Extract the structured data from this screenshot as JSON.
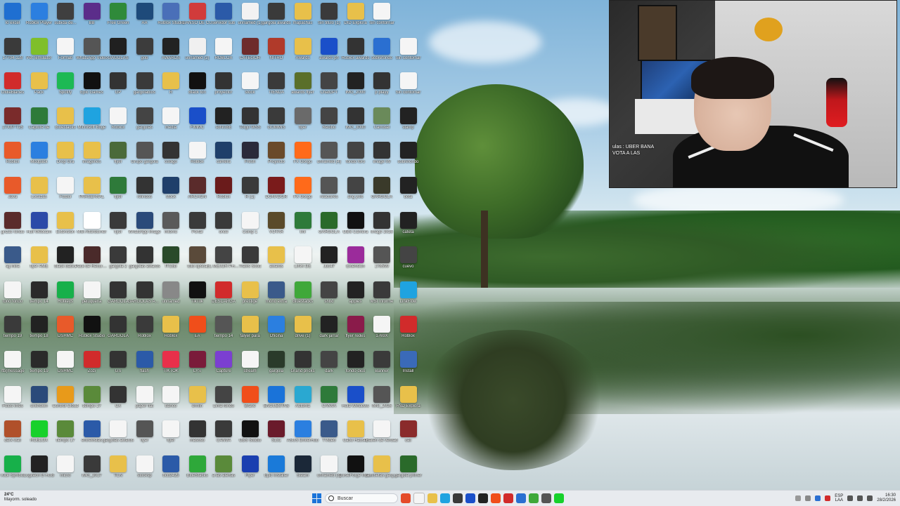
{
  "taskbar": {
    "weather_temp": "24°C",
    "weather_desc": "Mayorm. soleado",
    "search_label": "Buscar",
    "lang_top": "ESP",
    "lang_bottom": "LAA",
    "time": "16:30",
    "date": "28/2/2026"
  },
  "webcam": {
    "chat_line1": "ulas : UBER BANA",
    "chat_line2": "VOTA A LAS"
  },
  "colors": {
    "taskbar_bg": "#e8ebef",
    "start_blue": "#1a73d9"
  },
  "desktop": {
    "rows": [
      [
        "lo excel",
        "Roblox Player",
        "subida-de...",
        "BB",
        "Free Green",
        "AA",
        "Roblox Studio",
        "GANSO DE CU",
        "servidor sub",
        "unnamed (1)",
        "gargola awards",
        "mapachas",
        "Sin titulo (1)",
        "DID Explora",
        "Sin contornar"
      ],
      [
        "17704-128",
        "Pet Simulator",
        "Formati",
        "WhatsApp Video",
        "GAGOLAS",
        "gob",
        "AWARDS",
        "unnamed (2)",
        "ROBLOX",
        "CATEGOR",
        "NITRO",
        "Awards",
        "awards pn",
        "Roblox awards",
        "sobrefondo",
        "Sin contornar"
      ],
      [
        "OldieBlanes",
        "Pack",
        "Spotify",
        "Epic Games",
        "GP",
        "gargolabios",
        "R",
        "Black ton",
        "proyector",
        "stock",
        "TIENDA",
        "awards flyer",
        "ChatGPT",
        "IMG_2000",
        "p playy",
        "Sin contornar"
      ],
      [
        "17X07-T25",
        "Capture de",
        "Bluestacks",
        "Microsoft Edge",
        "Roblox",
        "gargolas",
        "media",
        "FIMMC",
        "sdNUBE",
        "Torgo WSS",
        "GOMMIS",
        "flyer",
        "Recibo",
        "IMG_3000",
        "Carrusel",
        "stamp"
      ],
      [
        "Roblox",
        "Modpack",
        "Drop Gra",
        "imagenes",
        "flyer",
        "Grupo gargola",
        "codigo",
        "Roblox",
        "camera",
        "Fresh",
        "Proyecto",
        "FX Gorgo",
        "unnamed (4)",
        "fondo foro",
        "image 09",
        "sobrefondo"
      ],
      [
        "Java",
        "Locazas",
        "Futbol",
        "PARSEANAL",
        "flyer",
        "relindos",
        "stock",
        "ARCHON",
        "Roblox",
        "R (1)",
        "DONADOR",
        "FX Gorgo",
        "reactores",
        "ang yols",
        "GARGOLA",
        "bota"
      ],
      [
        "gnzas fondo",
        "Huli Webcam",
        "Extension",
        "MSI Afterburner",
        "flyer",
        "WhatsApp Image",
        "mlomo",
        "Portal",
        "once",
        "Comp 1",
        "VOTAR",
        "Iml",
        "GARGOLA",
        "OBS Camera",
        "image 2026",
        "cafeta"
      ],
      [
        "sg mira",
        "flyer AME",
        "black backs",
        "Pack de Recursos",
        "gargola 2",
        "gargolas awards",
        "fTC8b",
        "toto upsca",
        "EL MEJOR PHONK",
        "Travis Scott",
        "awards",
        "LINK-DE",
        "Jbc47",
        "Extension",
        "178599",
        "cuevo"
      ],
      [
        "tono fondo",
        "tiempo 14",
        "Hotkeys",
        "peluqueria",
        "GARGOLA",
        "GARGOLAS AWARDS",
        "unnamed",
        "TikTok",
        "DESCARGA",
        "prestige",
        "mono extra",
        "Bluestacks",
        "shbd",
        "apples",
        "MSI Informe",
        "LinkFlow"
      ],
      [
        "tiempo 19",
        "tiempo 18",
        "DSHMC",
        "Roblox Studio",
        "GARGOLA",
        "Roblox",
        "Roblox",
        "EA",
        "tiempo 14",
        "falyer para",
        "Oficina",
        "drive (1)",
        "dark jarrar",
        "flyer redes",
        "1769X",
        "Roblox"
      ],
      [
        "rtb(message",
        "tiempo 19",
        "DSHMC",
        "Zozi",
        "GS",
        "flash",
        "TIKTOK",
        "LYS",
        "Capture",
        "stream",
        "gargola",
        "Grand pricks",
        "dark",
        "fondo dico",
        "Banner",
        "Install"
      ],
      [
        "Fotos imes",
        "unknown",
        "Control Cloud",
        "tiempo 17",
        "CX",
        "paper flat",
        "banco",
        "ermin",
        "Lima fondo",
        "Brave",
        "ENCUESTAS",
        "Automa",
        "CANVA",
        "Hola Windows",
        "IMG_2026",
        "FND Explora"
      ],
      [
        "dark wall",
        "ROBLOX",
        "tiempo 17",
        "entrevistas",
        "gargolas awards",
        "flyer",
        "flyer",
        "masoso",
        "CANVA",
        "OBS Studio",
        "5131",
        "ASUS DriverHub",
        "TVideo",
        "Cabo Hauser",
        "Bailen de verdad",
        "call"
      ],
      [
        "Kick Symbol",
        "Logitech G HUB",
        "micro",
        "IMG_2017",
        "TCN",
        "stocksp",
        "bcb2425",
        "BlueStacks",
        "a las alertas",
        "Flyer",
        "Epic Installer",
        "Steam",
        "unnamed (3)",
        "CurseForge Installer",
        "camisetas gargolas",
        "gargola primer"
      ]
    ],
    "icon_colors": [
      [
        "#1f6fd1",
        "#2b7fe0",
        "#3f3f3f",
        "#5b2d8a",
        "#2f8a3a",
        "#1e4a7a",
        "#4a6fb8",
        "#d13b3b",
        "#2b5aa8",
        "#f2f2f2",
        "#3a3a3a",
        "#e8c04a",
        "#3a3a3a",
        "#e8c04a",
        "#f5f5f5"
      ],
      [
        "#3a3a3a",
        "#7fbf2a",
        "#f5f5f5",
        "#555555",
        "#202020",
        "#3c3c3c",
        "#222222",
        "#f0f0f0",
        "#f5f5f5",
        "#6e2b2b",
        "#b03a2a",
        "#e8c04a",
        "#1a4fc9",
        "#333333",
        "#2a6fd1",
        "#f5f5f5"
      ],
      [
        "#d12b2b",
        "#e8c04a",
        "#1db954",
        "#111111",
        "#333333",
        "#3a3a3a",
        "#e8c04a",
        "#111111",
        "#333333",
        "#f5f5f5",
        "#3a3a3a",
        "#5a6f2a",
        "#444444",
        "#222222",
        "#333333",
        "#f5f5f5"
      ],
      [
        "#7a2b2b",
        "#2e7a3a",
        "#e8c04a",
        "#1fa3e0",
        "#f5f5f5",
        "#444444",
        "#f5f5f5",
        "#1a4fc9",
        "#222222",
        "#333333",
        "#3a3a3a",
        "#6a6a6a",
        "#444444",
        "#333333",
        "#6a8a5a",
        "#222222"
      ],
      [
        "#e85a2a",
        "#2b7fe0",
        "#e8c04a",
        "#e8c04a",
        "#4a6a3a",
        "#555555",
        "#333333",
        "#f5f5f5",
        "#1f3f6a",
        "#2a2a3a",
        "#6a4a2a",
        "#ff6a1a",
        "#555555",
        "#444444",
        "#333333",
        "#222222"
      ],
      [
        "#e85a2a",
        "#e8c04a",
        "#f5f5f5",
        "#e8c04a",
        "#2e7a3a",
        "#333333",
        "#1f3f6a",
        "#5a2b2b",
        "#6a1b1b",
        "#3a3a3a",
        "#7a1b1b",
        "#ff6a1a",
        "#555555",
        "#444444",
        "#3a3a2a",
        "#222222"
      ],
      [
        "#5a2b2b",
        "#2b4aa8",
        "#e8c04a",
        "#ffffff",
        "#3a3a3a",
        "#2a4a7a",
        "#5a5a5a",
        "#3a3a3a",
        "#3a3a3a",
        "#f5f5f5",
        "#5a4a2a",
        "#2e7a3a",
        "#2a6a2a",
        "#111111",
        "#333333",
        "#222222"
      ],
      [
        "#3a5a8a",
        "#e8c04a",
        "#222222",
        "#4a2a2a",
        "#3a3a3a",
        "#333333",
        "#2a4a2a",
        "#5a4a3a",
        "#444444",
        "#3a3a3a",
        "#e8c04a",
        "#f5f5f5",
        "#222222",
        "#9b2b9b",
        "#555555",
        "#444444"
      ],
      [
        "#f5f5f5",
        "#2a2a2a",
        "#17b04a",
        "#f5f5f5",
        "#333333",
        "#333333",
        "#888888",
        "#111111",
        "#d12b2b",
        "#e8c04a",
        "#3a5a8a",
        "#3fa83a",
        "#444444",
        "#222222",
        "#3a3a3a",
        "#1fa3e0"
      ],
      [
        "#3a3a3a",
        "#222222",
        "#e85a2a",
        "#111111",
        "#333333",
        "#3a3a3a",
        "#e8c04a",
        "#f04e1a",
        "#555555",
        "#e8c04a",
        "#2b7fe0",
        "#e8c04a",
        "#222222",
        "#8a1b4a",
        "#f5f5f5",
        "#d12b2b"
      ],
      [
        "#f5f5f5",
        "#2a2a2a",
        "#f5f5f5",
        "#d12b2b",
        "#333333",
        "#2b5aa8",
        "#e8304a",
        "#7a1b3a",
        "#7b3fd1",
        "#f5f5f5",
        "#2a3a2a",
        "#333333",
        "#444444",
        "#222222",
        "#3a3a3a",
        "#3a6ab8"
      ],
      [
        "#f5f5f5",
        "#2a4a7a",
        "#e89a1a",
        "#5a8a3a",
        "#333333",
        "#f5f5f5",
        "#f5f5f5",
        "#e8c04a",
        "#444444",
        "#f04e1a",
        "#1a73d9",
        "#2aa8d1",
        "#2e7a3a",
        "#1a4fc9",
        "#555555",
        "#e8c04a"
      ],
      [
        "#b0502a",
        "#17d12b",
        "#5a8a3a",
        "#2b5aa8",
        "#f5f5f5",
        "#555555",
        "#f5f5f5",
        "#333333",
        "#3a3a3a",
        "#111111",
        "#6a1b2b",
        "#2b7fe0",
        "#3a5a8a",
        "#e8c04a",
        "#f5f5f5",
        "#8a2b2b"
      ],
      [
        "#17b04a",
        "#222222",
        "#f5f5f5",
        "#3a3a3a",
        "#e8c04a",
        "#f5f5f5",
        "#2b5aa8",
        "#2ea83a",
        "#5a8a3a",
        "#1a3fb0",
        "#1a7ad9",
        "#1b2838",
        "#f5f5f5",
        "#111111",
        "#e8c04a",
        "#2a6a2a"
      ]
    ]
  }
}
